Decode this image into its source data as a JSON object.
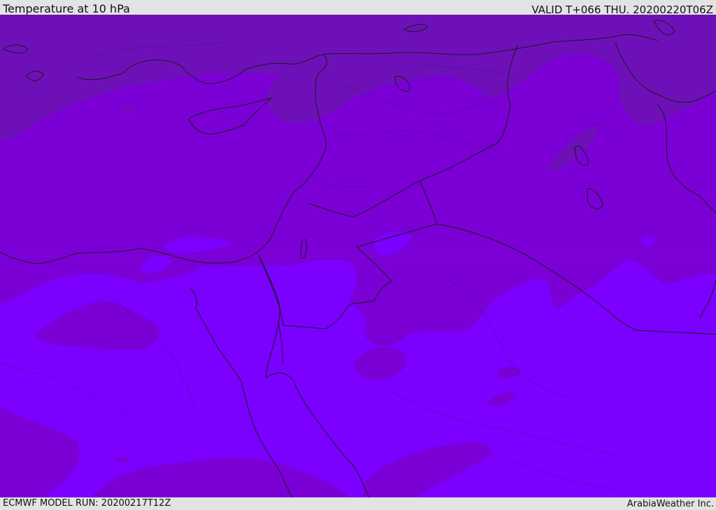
{
  "header": {
    "title": "Temperature at 10 hPa",
    "valid_time": "VALID T+066 THU. 20200220T06Z"
  },
  "footer": {
    "model_run": "ECMWF MODEL RUN: 20200217T12Z",
    "credit": "ArabiaWeather Inc."
  },
  "map": {
    "field": "Temperature at 10 hPa",
    "colors": {
      "band_cold": "#6d10b8",
      "band_mid": "#7a00d6",
      "band_warm": "#7b00ff",
      "border_line": "#1a1a1a",
      "country_border": "#1a1a1a"
    }
  }
}
